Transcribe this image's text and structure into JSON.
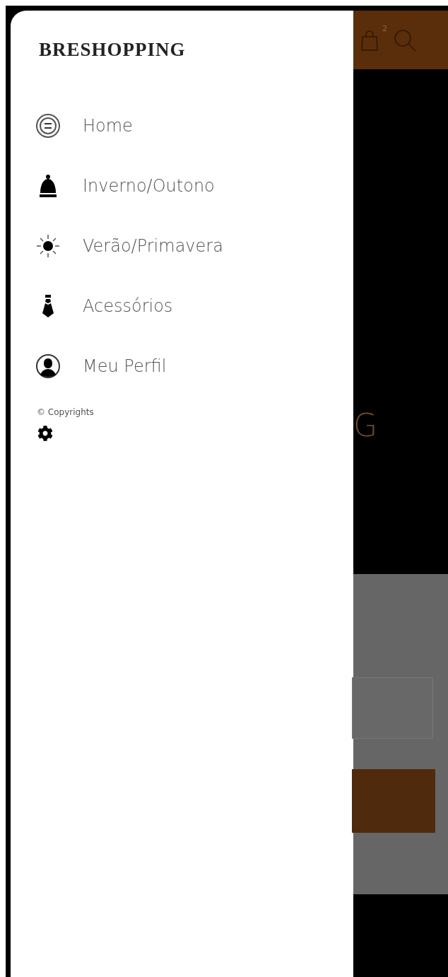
{
  "drawer": {
    "brand": "BRESHOPPING",
    "menu": [
      {
        "kind": "button",
        "label": "Home"
      },
      {
        "kind": "beanie",
        "label": "Inverno/Outono"
      },
      {
        "kind": "sun",
        "label": "Verão/Primavera"
      },
      {
        "kind": "tie",
        "label": "Acessórios"
      },
      {
        "kind": "profile",
        "label": "Meu Perfil"
      }
    ],
    "copyright": "© Copyrights"
  },
  "backdrop": {
    "cart_badge": "2",
    "hero_text": "G"
  }
}
